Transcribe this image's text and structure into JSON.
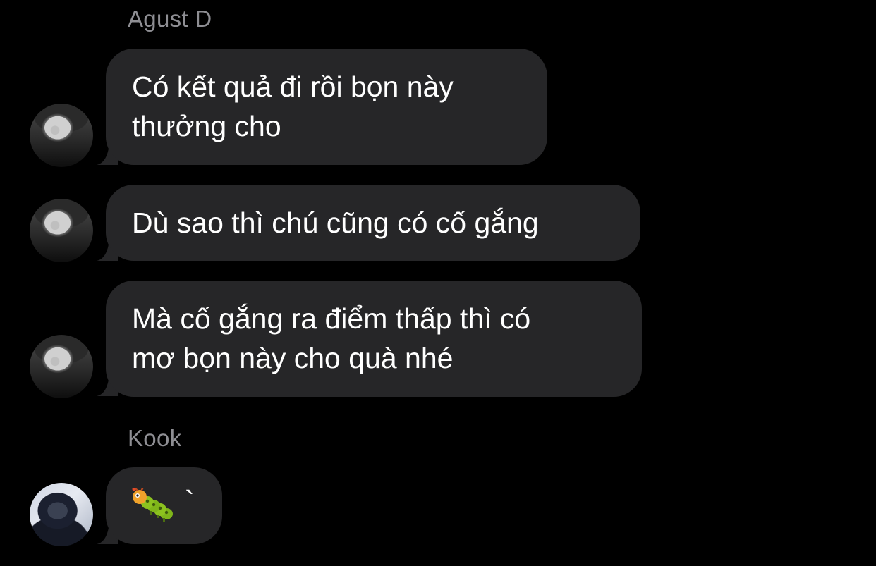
{
  "thread": {
    "group1": {
      "sender": "Agust D",
      "messages": [
        {
          "lines": [
            "Có kết quả đi rồi bọn này",
            "thưởng cho"
          ]
        },
        {
          "lines": [
            "Dù sao thì chú cũng có cố gắng"
          ]
        },
        {
          "lines": [
            "Mà cố gắng ra điểm thấp thì có",
            "mơ bọn này cho quà nhé"
          ]
        }
      ]
    },
    "group2": {
      "sender": "Kook",
      "messages": [
        {
          "emoji": "caterpillar-icon",
          "trailing_text": "`"
        }
      ]
    }
  },
  "colors": {
    "background": "#000000",
    "bubble": "#262628",
    "sender_name": "#8e8e93",
    "text": "#ffffff"
  }
}
